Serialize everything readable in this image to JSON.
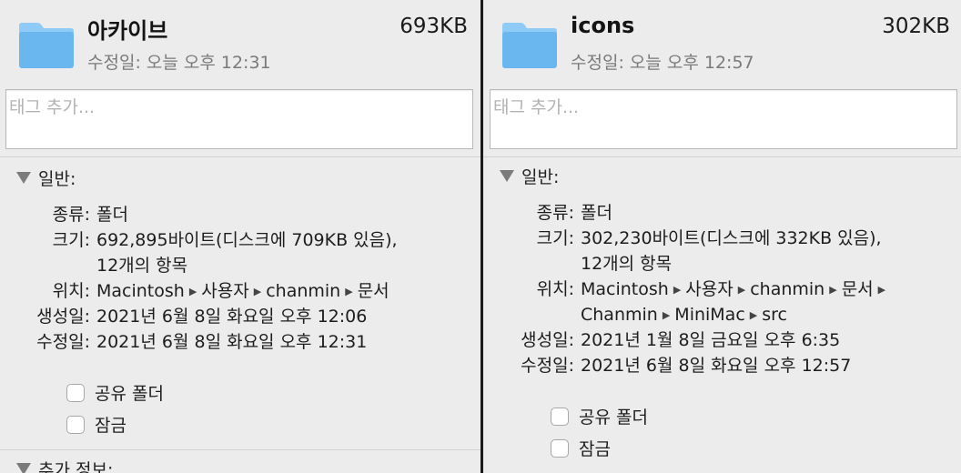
{
  "colors": {
    "folder_light": "#8fcbf6",
    "folder_main": "#6ab7f0",
    "divider": "#1a1a1a"
  },
  "left": {
    "name": "아카이브",
    "size": "693KB",
    "modified": "수정일: 오늘 오후 12:31",
    "tag_placeholder": "태그 추가...",
    "general_header": "일반:",
    "kind_label": "종류:",
    "kind_value": "폴더",
    "size_label": "크기:",
    "size_value": "692,895바이트(디스크에 709KB 있음),",
    "size_value2": "12개의 항목",
    "where_label": "위치:",
    "path": [
      "Macintosh",
      "사용자",
      "chanmin",
      "문서"
    ],
    "created_label": "생성일:",
    "created_value": "2021년 6월 8일 화요일 오후 12:06",
    "modified_label": "수정일:",
    "modified_value": "2021년 6월 8일 화요일 오후 12:31",
    "shared_folder": "공유 폴더",
    "locked": "잠금",
    "more_info_header": "추가 정보:"
  },
  "right": {
    "name": "icons",
    "size": "302KB",
    "modified": "수정일: 오늘 오후 12:57",
    "tag_placeholder": "태그 추가...",
    "general_header": "일반:",
    "kind_label": "종류:",
    "kind_value": "폴더",
    "size_label": "크기:",
    "size_value": "302,230바이트(디스크에 332KB 있음),",
    "size_value2": "12개의 항목",
    "where_label": "위치:",
    "path_line1": [
      "Macintosh",
      "사용자",
      "chanmin",
      "문서"
    ],
    "path_line2": [
      "Chanmin",
      "MiniMac",
      "src"
    ],
    "created_label": "생성일:",
    "created_value": "2021년 1월 8일 금요일 오후 6:35",
    "modified_label": "수정일:",
    "modified_value": "2021년 6월 8일 화요일 오후 12:57",
    "shared_folder": "공유 폴더",
    "locked": "잠금"
  }
}
